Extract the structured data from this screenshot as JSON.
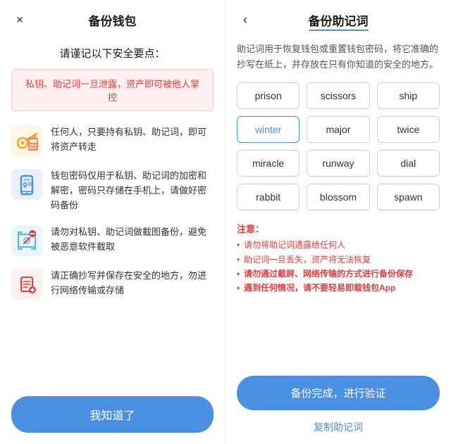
{
  "left": {
    "title": "备份钱包",
    "close_icon": "×",
    "subtitle": "请谨记以下安全要点：",
    "warning": "私钥、助记词一旦泄露，资产即可被他人掌控",
    "security_items": [
      {
        "icon": "key-icon",
        "text": "任何人，只要持有私钥、助记词，即可将资产转走"
      },
      {
        "icon": "phone-icon",
        "text": "钱包密码仅用于私钥、助记词的加密和解密，密码只存储在手机上，请做好密码备份"
      },
      {
        "icon": "screenshot-icon",
        "text": "请勿对私钥、助记词做截图备份，避免被恶意软件截取"
      },
      {
        "icon": "save-icon",
        "text": "请正确抄写并保存在安全的地方，勿进行网络传输或存储"
      }
    ],
    "bottom_btn": "我知道了"
  },
  "right": {
    "title": "备份助记词",
    "back_icon": "‹",
    "desc": "助记词用于恢复钱包或重置钱包密码，将它准确的抄写在纸上，并存放在只有你知道的安全的地方。",
    "mnemonic_words": [
      "prison",
      "scissors",
      "ship",
      "winter",
      "major",
      "twice",
      "miracle",
      "runway",
      "dial",
      "rabbit",
      "blossom",
      "spawn"
    ],
    "highlighted_word": "winter",
    "notes_title": "注意：",
    "notes": [
      {
        "text": "请勿将助记词透露给任何人",
        "bold": false
      },
      {
        "text": "助记词一旦丢失，资产将无法恢复",
        "bold": false
      },
      {
        "text": "请勿通过截屏、网络传输的方式进行备份保存",
        "bold": true
      },
      {
        "text": "遇到任何情况，请不要轻易卸载钱包App",
        "bold": true
      }
    ],
    "backup_btn": "备份完成，进行验证",
    "copy_link": "复制助记词"
  }
}
